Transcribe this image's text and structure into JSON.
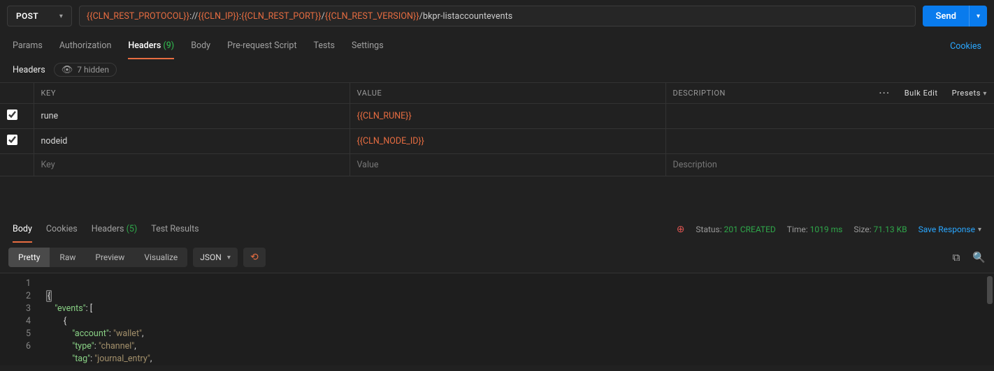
{
  "request": {
    "method": "POST",
    "url": {
      "protocol_var": "{{CLN_REST_PROTOCOL}}",
      "sep1": "://",
      "ip_var": "{{CLN_IP}}",
      "colon": ":",
      "port_var": "{{CLN_REST_PORT}}",
      "slash1": "/",
      "version_var": "{{CLN_REST_VERSION}}",
      "path": "/bkpr-listaccountevents"
    },
    "send_label": "Send"
  },
  "tabs": {
    "params": "Params",
    "authorization": "Authorization",
    "headers_label": "Headers",
    "headers_count": "(9)",
    "body": "Body",
    "prerequest": "Pre-request Script",
    "tests": "Tests",
    "settings": "Settings",
    "cookies": "Cookies"
  },
  "headers_section": {
    "title": "Headers",
    "hidden_text": "7 hidden",
    "columns": {
      "key": "KEY",
      "value": "VALUE",
      "description": "DESCRIPTION"
    },
    "actions": {
      "bulk": "Bulk Edit",
      "presets": "Presets"
    },
    "rows": [
      {
        "checked": true,
        "key": "rune",
        "value": "{{CLN_RUNE}}",
        "desc": ""
      },
      {
        "checked": true,
        "key": "nodeid",
        "value": "{{CLN_NODE_ID}}",
        "desc": ""
      }
    ],
    "placeholders": {
      "key": "Key",
      "value": "Value",
      "desc": "Description"
    }
  },
  "response_tabs": {
    "body": "Body",
    "cookies": "Cookies",
    "headers_label": "Headers",
    "headers_count": "(5)",
    "test_results": "Test Results"
  },
  "response_meta": {
    "status_label": "Status:",
    "status_value": "201 CREATED",
    "time_label": "Time:",
    "time_value": "1019 ms",
    "size_label": "Size:",
    "size_value": "71.13 KB",
    "save_label": "Save Response"
  },
  "viewbar": {
    "pretty": "Pretty",
    "raw": "Raw",
    "preview": "Preview",
    "visualize": "Visualize",
    "lang": "JSON"
  },
  "code": {
    "lines": [
      "1",
      "2",
      "3",
      "4",
      "5",
      "6"
    ],
    "l2_key": "\"events\"",
    "l4_key": "\"account\"",
    "l4_val": "\"wallet\"",
    "l5_key": "\"type\"",
    "l5_val": "\"channel\"",
    "l6_key": "\"tag\"",
    "l6_val": "\"journal_entry\""
  }
}
